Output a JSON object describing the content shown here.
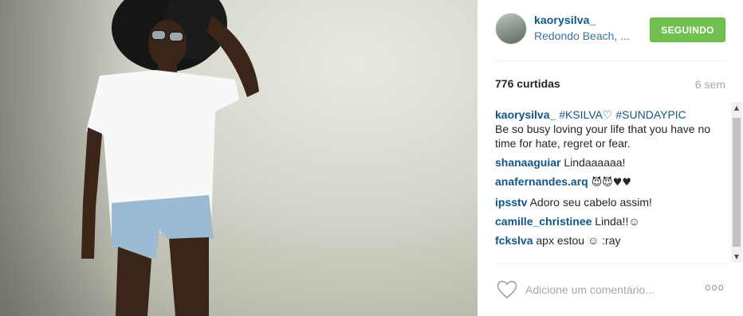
{
  "post": {
    "author": "kaorysilva_",
    "location": "Redondo Beach, ...",
    "follow_label": "SEGUINDO",
    "likes": "776 curtidas",
    "time_ago": "6 sem"
  },
  "caption": {
    "user": "kaorysilva_",
    "tags": "#KSILVA♡ #SUNDAYPIC",
    "text": "Be so busy loving your life that you have no time for hate, regret or fear."
  },
  "comments": [
    {
      "user": "shanaaguiar",
      "text": "Lindaaaaaa!"
    },
    {
      "user": "anafernandes.arq",
      "text": "😈😈♥♥"
    },
    {
      "user": "ipsstv",
      "text": "Adoro seu cabelo assim!"
    },
    {
      "user": "camille_christinee",
      "text": "Linda!!☺"
    },
    {
      "user": "fckslva",
      "text": "apx estou ☺ :ray"
    }
  ],
  "footer": {
    "comment_placeholder": "Adicione um comentário...",
    "more_label": "ooo"
  },
  "colors": {
    "username": "#125688",
    "location": "#3f729b",
    "follow": "#70c050",
    "muted": "#a5a7aa"
  },
  "icons": {
    "like": "heart-outline-icon",
    "more": "more-options-icon"
  }
}
